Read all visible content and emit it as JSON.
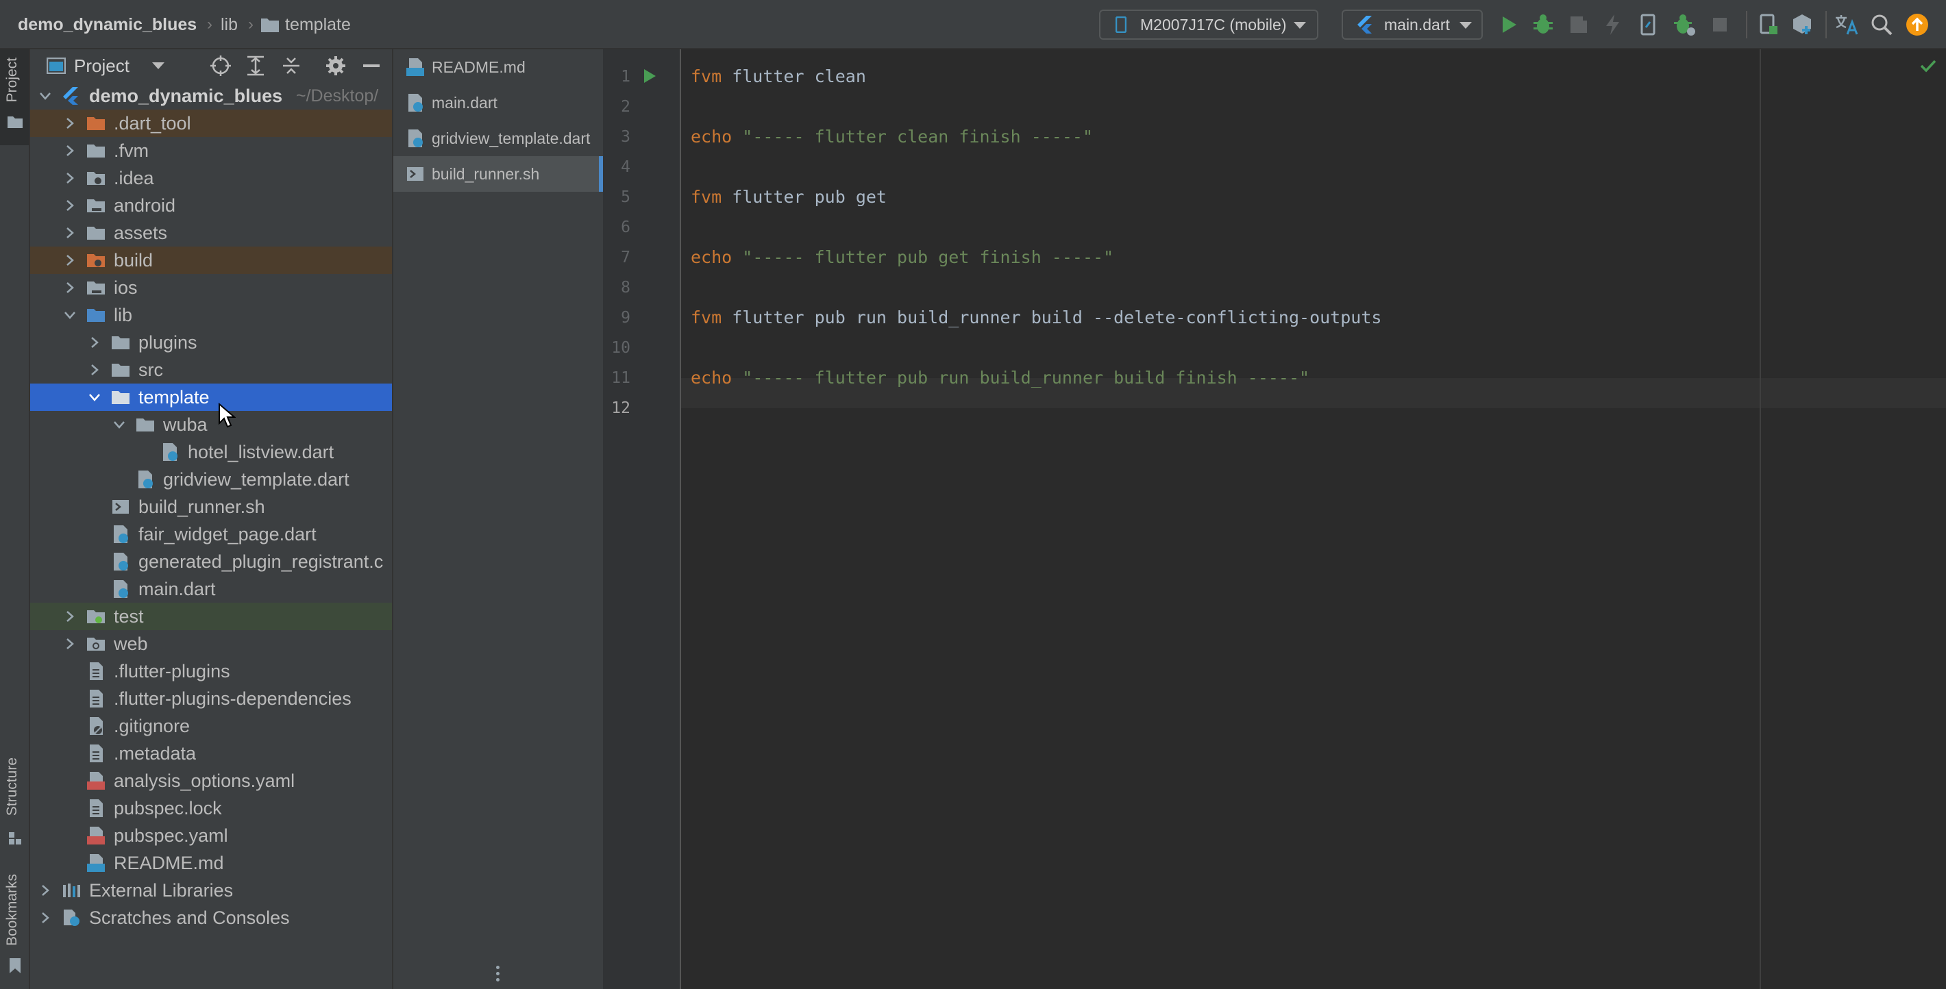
{
  "breadcrumb": {
    "project": "demo_dynamic_blues",
    "lib": "lib",
    "current": "template"
  },
  "toolbar": {
    "device": "M2007J17C (mobile)",
    "run_config": "main.dart",
    "icons": [
      "run-icon",
      "debug-icon",
      "coverage-icon",
      "hot-reload-icon",
      "device-file-icon",
      "attach-debugger-icon",
      "stop-icon",
      "device-manager-icon",
      "sdk-manager-icon",
      "translate-icon",
      "search-icon",
      "update-icon"
    ]
  },
  "sidebar": {
    "project_tab": "Project",
    "structure_tab": "Structure",
    "bookmarks_tab": "Bookmarks"
  },
  "panel": {
    "title": "Project"
  },
  "tree": {
    "root": "demo_dynamic_blues",
    "root_hint": "~/Desktop/",
    "items": [
      {
        "label": ".dart_tool"
      },
      {
        "label": ".fvm"
      },
      {
        "label": ".idea"
      },
      {
        "label": "android"
      },
      {
        "label": "assets"
      },
      {
        "label": "build"
      },
      {
        "label": "ios"
      },
      {
        "label": "lib"
      },
      {
        "label": "plugins"
      },
      {
        "label": "src"
      },
      {
        "label": "template"
      },
      {
        "label": "wuba"
      },
      {
        "label": "hotel_listview.dart"
      },
      {
        "label": "gridview_template.dart"
      },
      {
        "label": "build_runner.sh"
      },
      {
        "label": "fair_widget_page.dart"
      },
      {
        "label": "generated_plugin_registrant.c"
      },
      {
        "label": "main.dart"
      },
      {
        "label": "test"
      },
      {
        "label": "web"
      },
      {
        "label": ".flutter-plugins"
      },
      {
        "label": ".flutter-plugins-dependencies"
      },
      {
        "label": ".gitignore"
      },
      {
        "label": ".metadata"
      },
      {
        "label": "analysis_options.yaml"
      },
      {
        "label": "pubspec.lock"
      },
      {
        "label": "pubspec.yaml"
      },
      {
        "label": "README.md"
      },
      {
        "label": "External Libraries"
      },
      {
        "label": "Scratches and Consoles"
      }
    ]
  },
  "editor_tabs": [
    {
      "label": "README.md"
    },
    {
      "label": "main.dart"
    },
    {
      "label": "gridview_template.dart"
    },
    {
      "label": "build_runner.sh"
    }
  ],
  "editor": {
    "line_numbers": [
      "1",
      "2",
      "3",
      "4",
      "5",
      "6",
      "7",
      "8",
      "9",
      "10",
      "11",
      "12"
    ],
    "lines": [
      {
        "kw": "fvm",
        "rest": " flutter clean"
      },
      {
        "kw": "echo",
        "str": " \"----- flutter clean finish -----\""
      },
      {
        "kw": "fvm",
        "rest": " flutter pub get"
      },
      {
        "kw": "echo",
        "str": " \"----- flutter pub get finish -----\""
      },
      {
        "kw": "fvm",
        "rest": " flutter pub run build_runner build --delete-conflicting-outputs"
      },
      {
        "kw": "echo",
        "str": " \"----- flutter pub run build_runner build finish -----\""
      }
    ]
  }
}
